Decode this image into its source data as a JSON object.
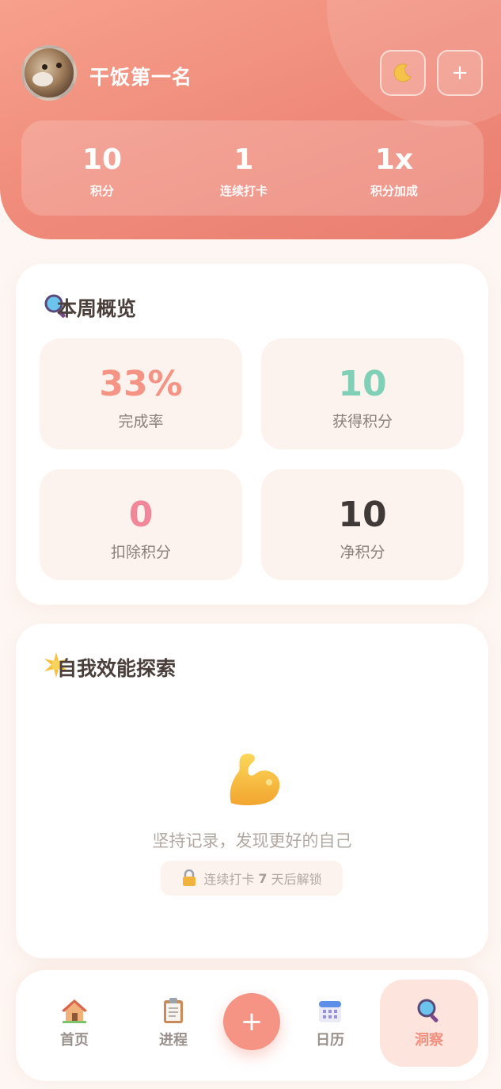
{
  "header": {
    "user_name": "干饭第一名",
    "theme_toggle_icon": "moon-icon",
    "add_icon_glyph": "+",
    "stats": [
      {
        "value": "10",
        "label": "积分"
      },
      {
        "value": "1",
        "label": "连续打卡"
      },
      {
        "value": "1x",
        "label": "积分加成"
      }
    ]
  },
  "weekly": {
    "title": "本周概览",
    "icon": "magnifier-icon",
    "tiles": [
      {
        "value": "33%",
        "label": "完成率",
        "color": "#f59385"
      },
      {
        "value": "10",
        "label": "获得积分",
        "color": "#7fd0b6"
      },
      {
        "value": "0",
        "label": "扣除积分",
        "color": "#f0889a"
      },
      {
        "value": "10",
        "label": "净积分",
        "color": "#3f3a38"
      }
    ]
  },
  "efficacy": {
    "title": "自我效能探索",
    "icon": "sparkle-icon",
    "empty_text": "坚持记录，发现更好的自己",
    "lock_prefix": "连续打卡",
    "lock_days": "7",
    "lock_suffix": "天后解锁"
  },
  "nav": {
    "items": [
      {
        "label": "首页",
        "icon": "house-icon"
      },
      {
        "label": "进程",
        "icon": "clipboard-icon"
      },
      {
        "label": "日历",
        "icon": "calendar-icon"
      },
      {
        "label": "洞察",
        "icon": "magnifier-icon",
        "active": true
      }
    ],
    "fab_glyph": "+"
  },
  "colors": {
    "accent": "#f59385",
    "header_gradient_start": "#f7a08c",
    "header_gradient_end": "#e97e70",
    "background": "#fdf6f2"
  }
}
